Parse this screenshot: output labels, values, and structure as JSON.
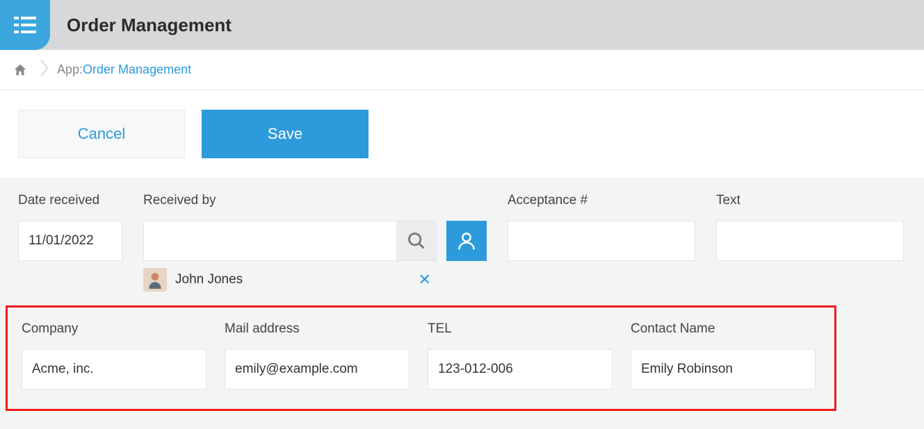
{
  "header": {
    "title": "Order Management"
  },
  "breadcrumb": {
    "app_label": "App: ",
    "app_link": "Order Management"
  },
  "toolbar": {
    "cancel_label": "Cancel",
    "save_label": "Save"
  },
  "fields": {
    "date_received": {
      "label": "Date received",
      "value": "11/01/2022"
    },
    "received_by": {
      "label": "Received by",
      "value": "",
      "selected_user": "John Jones"
    },
    "acceptance": {
      "label": "Acceptance #",
      "value": ""
    },
    "text": {
      "label": "Text",
      "value": ""
    }
  },
  "highlight": {
    "company": {
      "label": "Company",
      "value": "Acme, inc."
    },
    "mail": {
      "label": "Mail address",
      "value": "emily@example.com"
    },
    "tel": {
      "label": "TEL",
      "value": "123-012-006"
    },
    "contact": {
      "label": "Contact Name",
      "value": "Emily Robinson"
    }
  }
}
